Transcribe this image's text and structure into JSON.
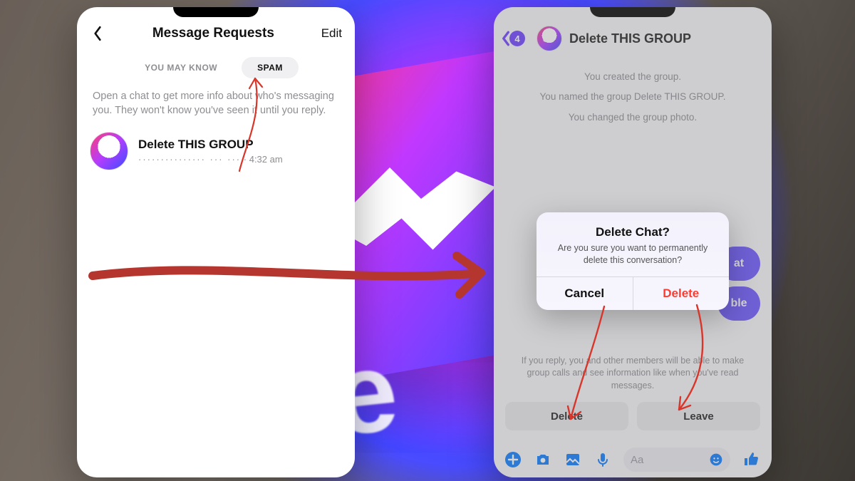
{
  "left": {
    "header": {
      "title": "Message Requests",
      "edit": "Edit"
    },
    "tabs": {
      "you_may_know": "YOU MAY KNOW",
      "spam": "SPAM"
    },
    "info": "Open a chat to get more info about who's messaging you. They won't know you've seen it until you reply.",
    "thread": {
      "title": "Delete THIS GROUP",
      "time": "4:32 am",
      "time_prefix": "· "
    }
  },
  "right": {
    "back_badge": "4",
    "title": "Delete THIS GROUP",
    "system": {
      "l1": "You created the group.",
      "l2": "You named the group Delete THIS GROUP.",
      "l3": "You changed the group photo."
    },
    "peek": {
      "chat": "at",
      "ble": "ble"
    },
    "alert": {
      "title": "Delete Chat?",
      "message": "Are you sure you want to permanently delete this conversation?",
      "cancel": "Cancel",
      "delete": "Delete"
    },
    "reply_note": "If you reply, you and other members will be able to make group calls and see information like when you've read messages.",
    "bottom": {
      "delete": "Delete",
      "leave": "Leave"
    },
    "input_placeholder": "Aa"
  }
}
